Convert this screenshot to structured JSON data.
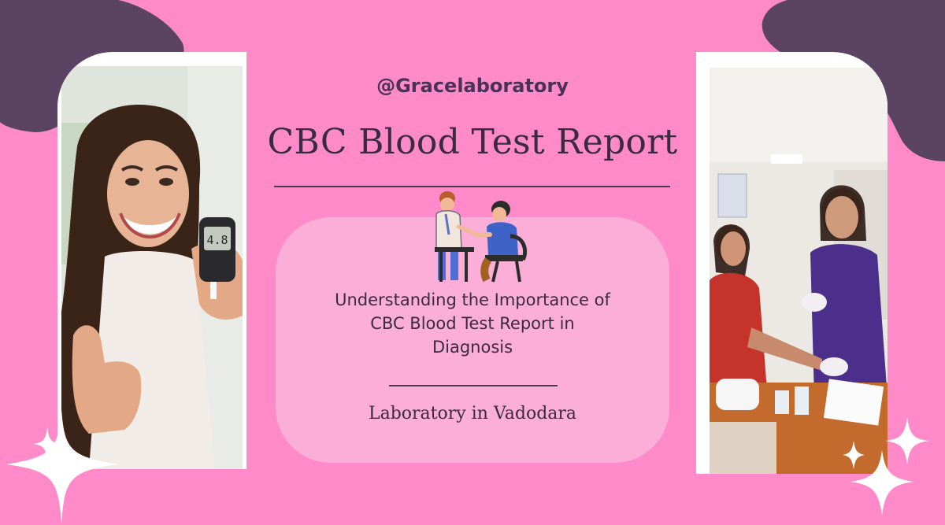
{
  "header": {
    "handle": "@Gracelaboratory",
    "title": "CBC Blood Test Report"
  },
  "card": {
    "subtitle_lines": [
      "Understanding the Importance of",
      "CBC Blood Test Report in",
      "Diagnosis"
    ],
    "location": "Laboratory in Vadodara"
  },
  "photos": {
    "left_meter_reading": "4.8"
  },
  "colors": {
    "background": "#ff8ac9",
    "blob": "#5b4463",
    "panel": "#fbafd8",
    "text": "#3a2a44",
    "scrubs": "#4b2f8a"
  },
  "icons": {
    "illustration": "nurse-patient-illustration",
    "sparkles": "sparkle-icon"
  }
}
